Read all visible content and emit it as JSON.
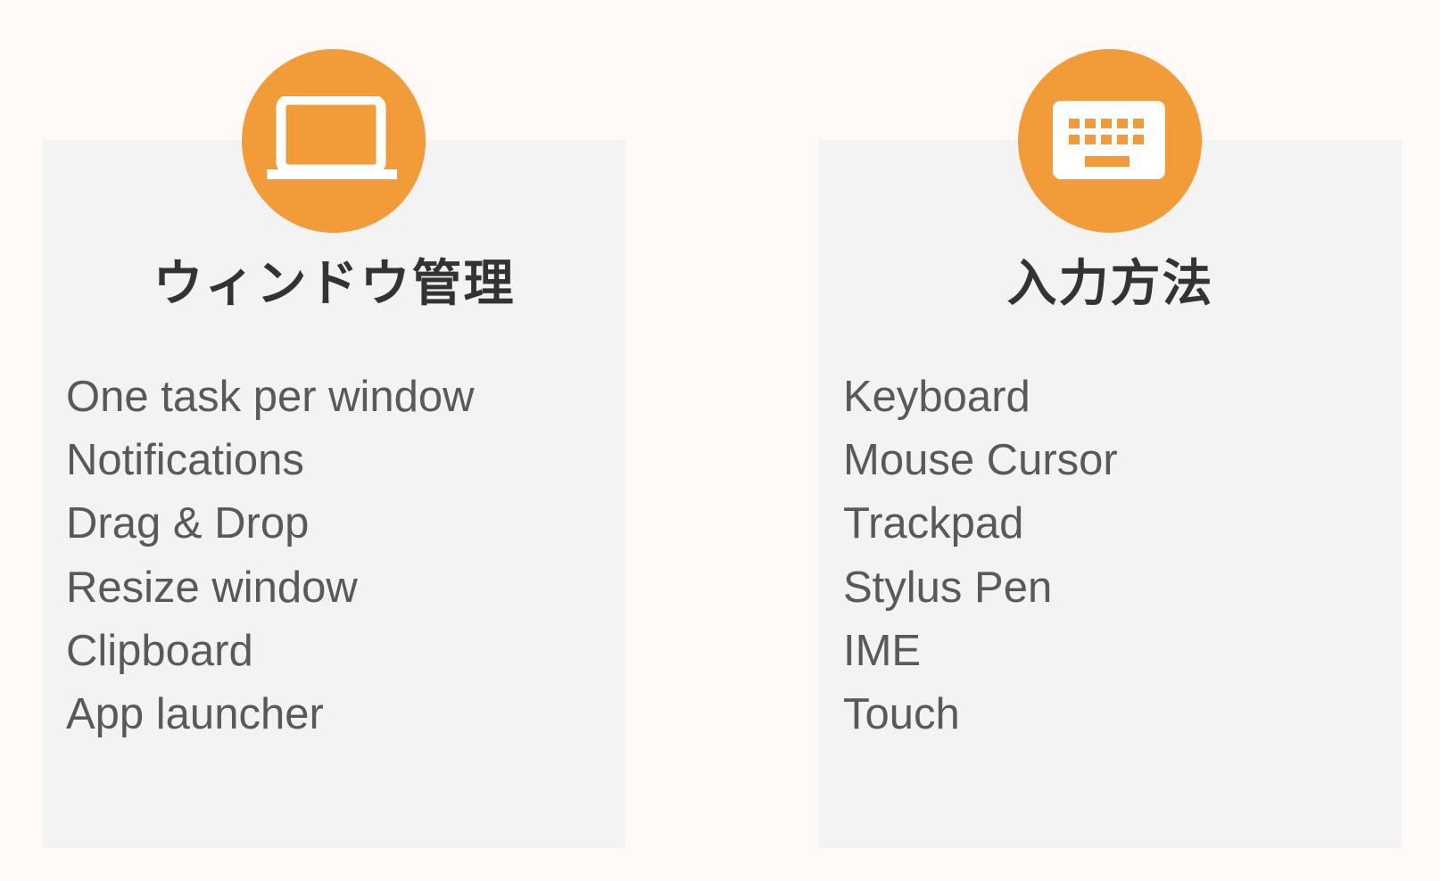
{
  "colors": {
    "background": "#fffaf8",
    "card": "#f3f3f3",
    "accent": "#f19c39",
    "heading": "#333333",
    "body_text": "#595959"
  },
  "cards": [
    {
      "icon": "laptop-icon",
      "title": "ウィンドウ管理",
      "items": [
        "One task per window",
        "Notifications",
        "Drag & Drop",
        "Resize window",
        "Clipboard",
        "App launcher"
      ]
    },
    {
      "icon": "keyboard-icon",
      "title": "入力方法",
      "items": [
        "Keyboard",
        "Mouse Cursor",
        "Trackpad",
        "Stylus Pen",
        "IME",
        "Touch"
      ]
    }
  ]
}
